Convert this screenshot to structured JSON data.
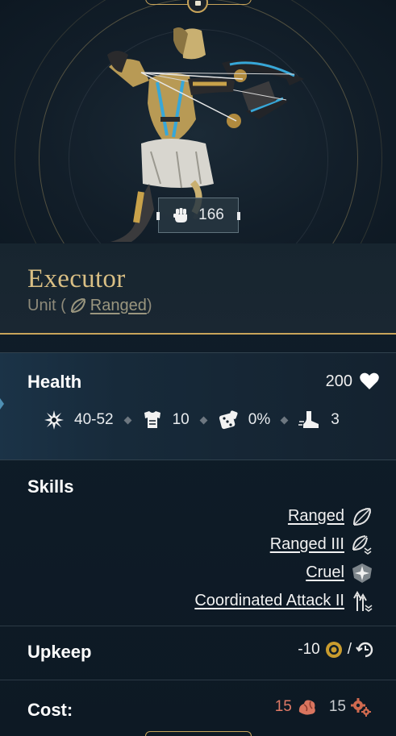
{
  "unit": {
    "name": "Executor",
    "type_prefix": "Unit (",
    "type_class": "Ranged",
    "type_suffix": ")",
    "power": "166"
  },
  "health": {
    "title": "Health",
    "value": "200",
    "stats": {
      "damage": "40-52",
      "armor": "10",
      "crit": "0%",
      "movement": "3"
    }
  },
  "skills": {
    "title": "Skills",
    "items": [
      {
        "label": "Ranged",
        "icon": "bow-icon"
      },
      {
        "label": "Ranged III",
        "icon": "bow-chevrons-icon"
      },
      {
        "label": "Cruel",
        "icon": "star-shield-icon"
      },
      {
        "label": "Coordinated Attack II",
        "icon": "arrows-up-icon"
      }
    ]
  },
  "upkeep": {
    "title": "Upkeep",
    "value": "-10",
    "separator": "/"
  },
  "cost": {
    "title": "Cost:",
    "amount_a": "15",
    "amount_b": "15"
  },
  "colors": {
    "gold": "#c8a45a",
    "name_gold": "#d9bf84",
    "cost_red": "#e07a66",
    "cyan_accent": "#37a7d8"
  }
}
